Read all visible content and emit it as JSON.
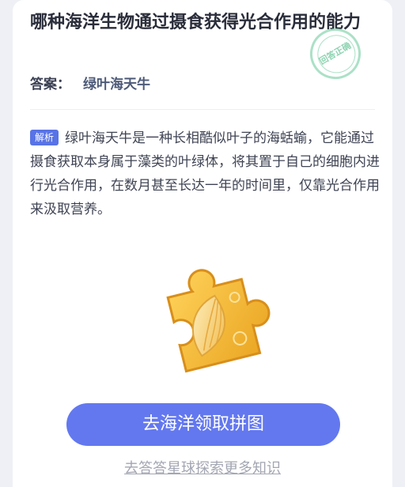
{
  "question": {
    "title": "哪种海洋生物通过摄食获得光合作用的能力"
  },
  "stamp": {
    "text": "回答正确"
  },
  "answer": {
    "label": "答案：",
    "value": "绿叶海天牛"
  },
  "explanation": {
    "tag": "解析",
    "text": "绿叶海天牛是一种长相酷似叶子的海蛞蝓，它能通过摄食获取本身属于藻类的叶绿体，将其置于自己的细胞内进行光合作用，在数月甚至长达一年的时间里，仅靠光合作用来汲取营养。"
  },
  "actions": {
    "primary_label": "去海洋领取拼图",
    "secondary_label": "去答答星球探索更多知识"
  },
  "colors": {
    "accent": "#6378ef",
    "tag": "#5873e6",
    "stamp": "#8fd8b4",
    "puzzle": "#f4b43a"
  },
  "icons": {
    "reward": "puzzle-piece-icon",
    "stamp": "correct-stamp-icon"
  }
}
